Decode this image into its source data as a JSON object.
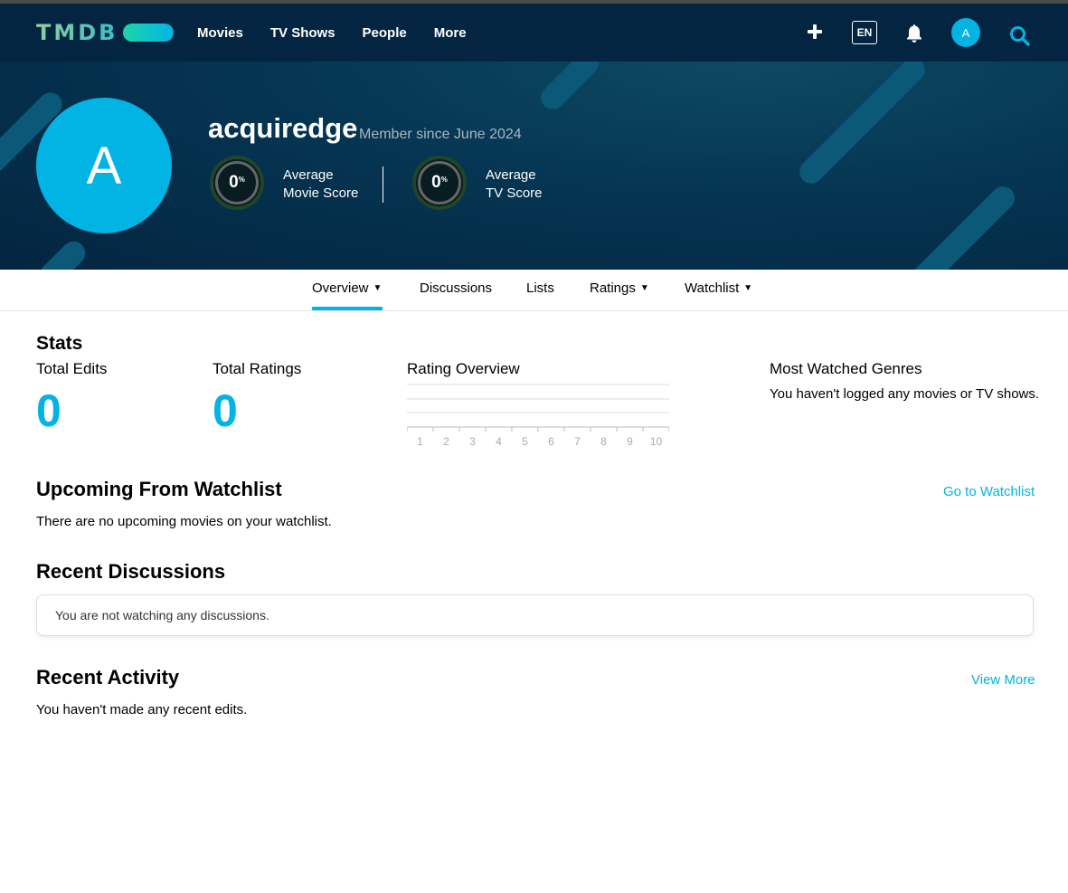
{
  "nav": {
    "logo_text": "TMDB",
    "links": [
      "Movies",
      "TV Shows",
      "People",
      "More"
    ],
    "lang": "EN",
    "avatar_letter": "A",
    "icons": [
      "plus-icon",
      "bell-icon",
      "search-icon"
    ]
  },
  "profile": {
    "avatar_letter": "A",
    "username": "acquiredge",
    "member_since": "Member since June 2024",
    "movie_score": {
      "value": "0",
      "unit": "%",
      "label_1": "Average",
      "label_2": "Movie Score"
    },
    "tv_score": {
      "value": "0",
      "unit": "%",
      "label_1": "Average",
      "label_2": "TV Score"
    }
  },
  "tabs": [
    {
      "label": "Overview",
      "dropdown": true,
      "active": true
    },
    {
      "label": "Discussions",
      "dropdown": false,
      "active": false
    },
    {
      "label": "Lists",
      "dropdown": false,
      "active": false
    },
    {
      "label": "Ratings",
      "dropdown": true,
      "active": false
    },
    {
      "label": "Watchlist",
      "dropdown": true,
      "active": false
    }
  ],
  "stats": {
    "heading": "Stats",
    "total_edits_label": "Total Edits",
    "total_edits_value": "0",
    "total_ratings_label": "Total Ratings",
    "total_ratings_value": "0",
    "rating_overview_label": "Rating Overview",
    "rating_ticks": [
      "1",
      "2",
      "3",
      "4",
      "5",
      "6",
      "7",
      "8",
      "9",
      "10"
    ],
    "genres_label": "Most Watched Genres",
    "genres_empty": "You haven't logged any movies or TV shows."
  },
  "upcoming": {
    "heading": "Upcoming From Watchlist",
    "link": "Go to Watchlist",
    "empty": "There are no upcoming movies on your watchlist."
  },
  "discussions": {
    "heading": "Recent Discussions",
    "empty": "You are not watching any discussions."
  },
  "activity": {
    "heading": "Recent Activity",
    "link": "View More",
    "empty": "You haven't made any recent edits."
  },
  "colors": {
    "navy": "#032541",
    "accent": "#01b4e4"
  }
}
